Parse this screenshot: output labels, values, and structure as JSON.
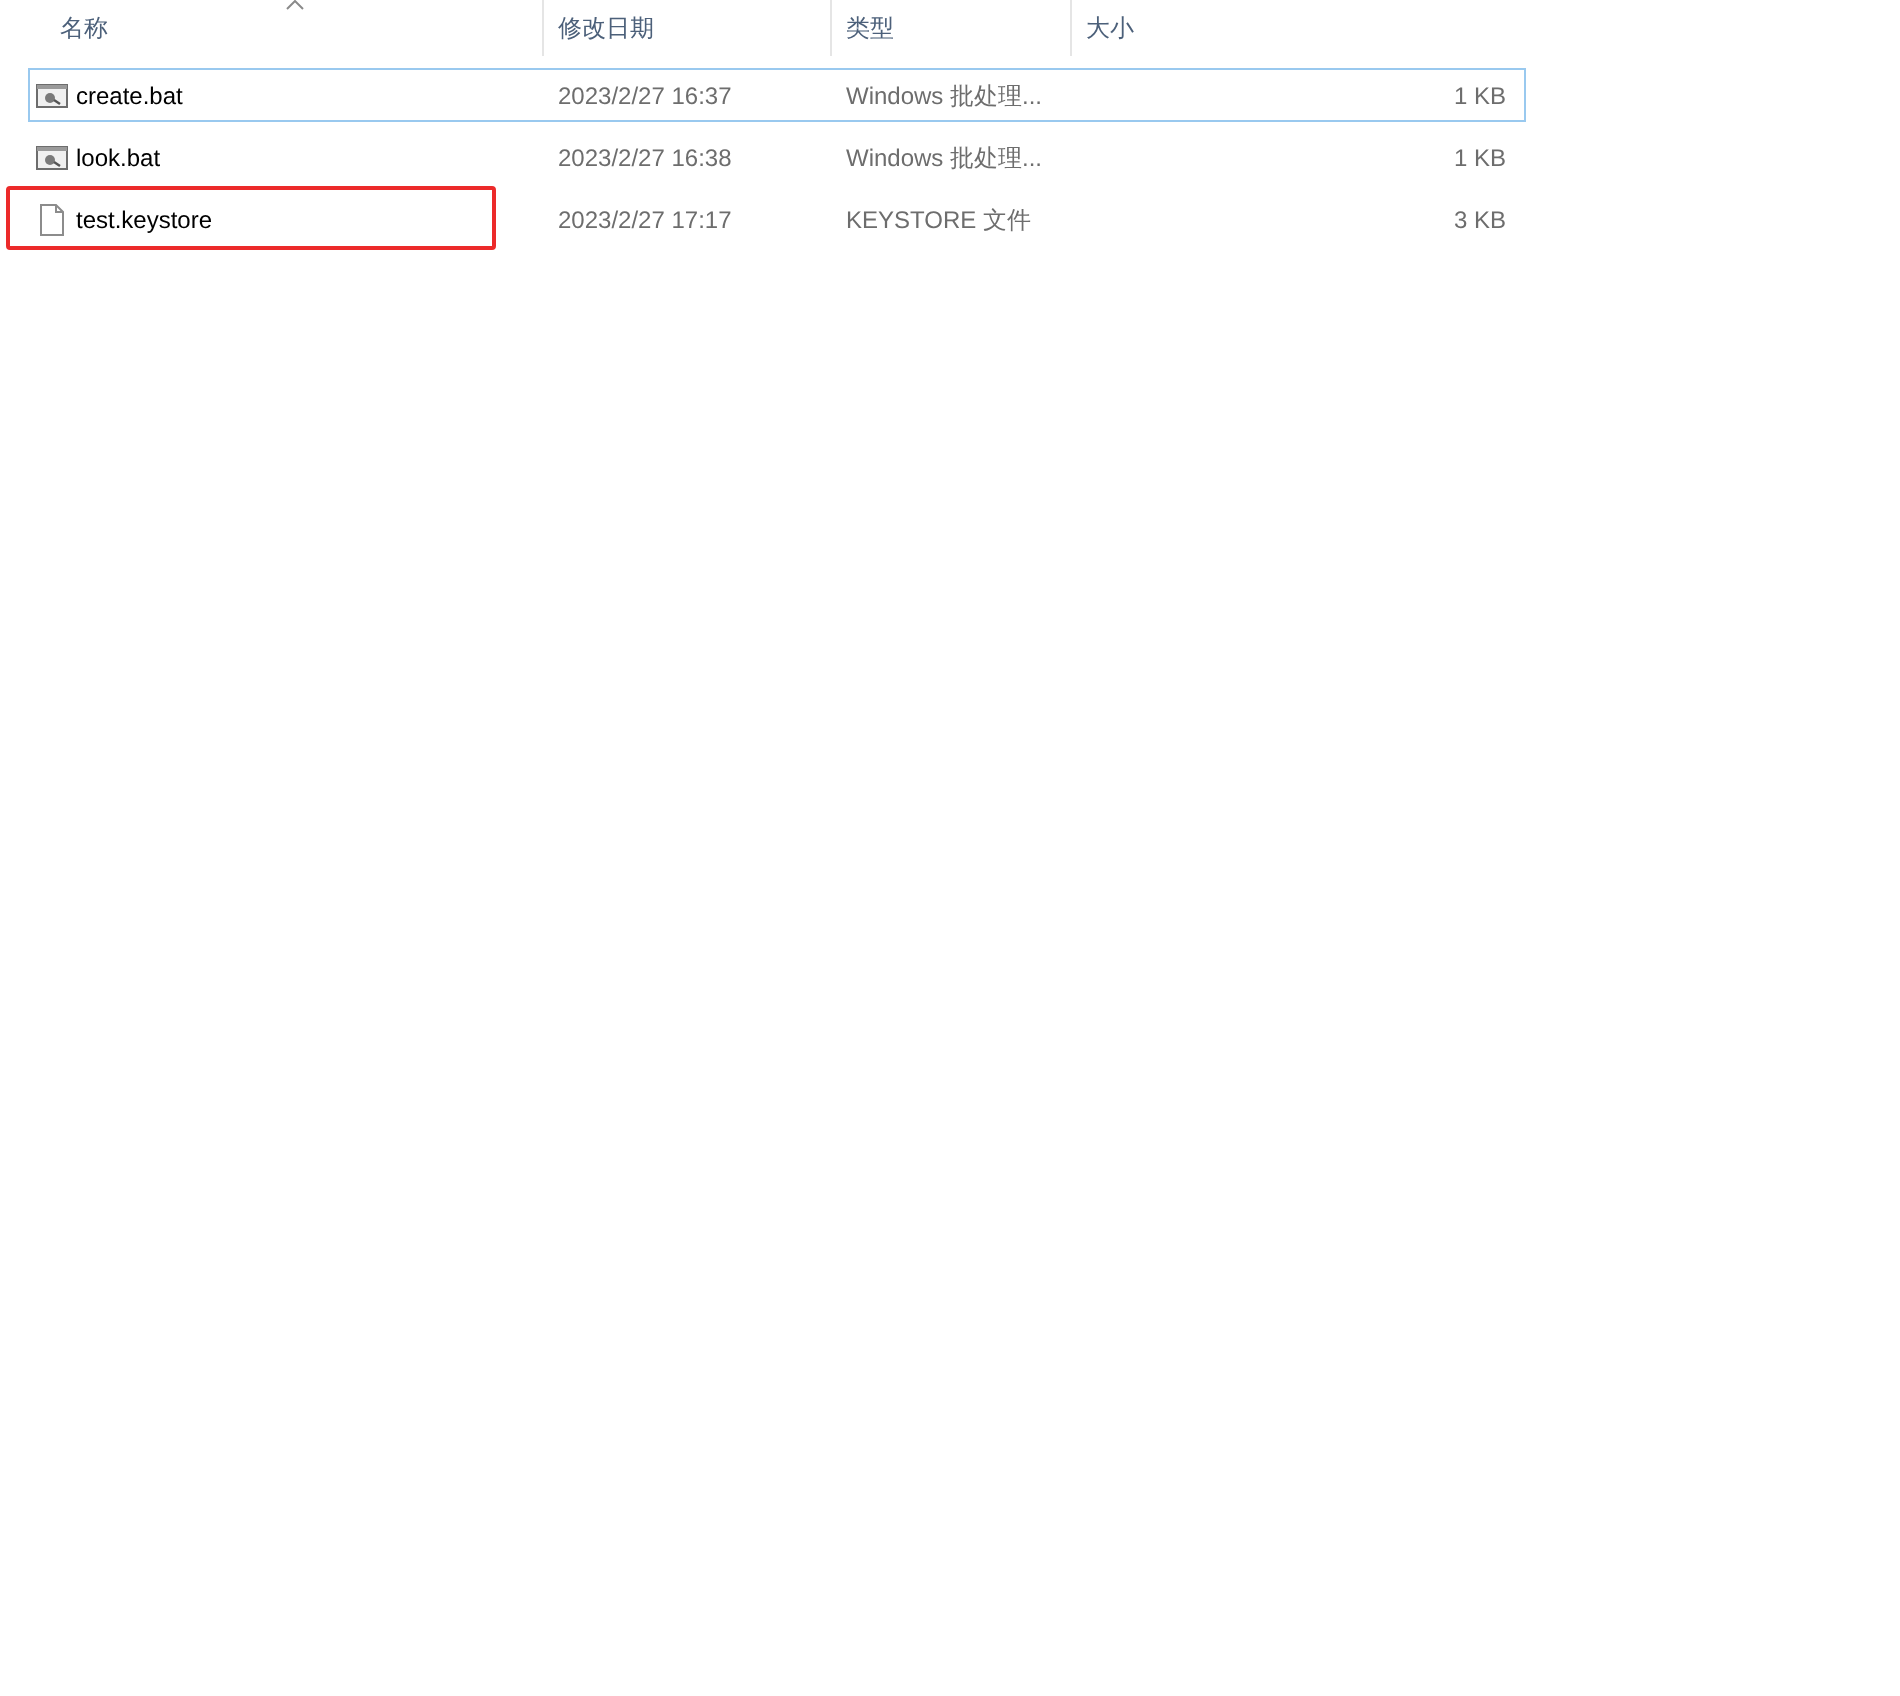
{
  "table": {
    "columns": [
      {
        "label": "名称",
        "sorted": true
      },
      {
        "label": "修改日期",
        "sorted": false
      },
      {
        "label": "类型",
        "sorted": false
      },
      {
        "label": "大小",
        "sorted": false
      }
    ],
    "rows": [
      {
        "kind": "batch",
        "name": "create.bat",
        "modified": "2023/2/27 16:37",
        "type": "Windows 批处理...",
        "size": "1 KB",
        "focused": true,
        "annotated": false
      },
      {
        "kind": "batch",
        "name": "look.bat",
        "modified": "2023/2/27 16:38",
        "type": "Windows 批处理...",
        "size": "1 KB",
        "focused": false,
        "annotated": false
      },
      {
        "kind": "file",
        "name": "test.keystore",
        "modified": "2023/2/27 17:17",
        "type": "KEYSTORE 文件",
        "size": "3 KB",
        "focused": false,
        "annotated": true
      }
    ]
  }
}
